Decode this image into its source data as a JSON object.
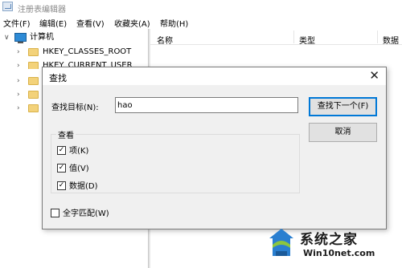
{
  "app": {
    "title": "注册表编辑器"
  },
  "menu": [
    {
      "label": "文件(F)"
    },
    {
      "label": "编辑(E)"
    },
    {
      "label": "查看(V)"
    },
    {
      "label": "收藏夹(A)"
    },
    {
      "label": "帮助(H)"
    }
  ],
  "tree": {
    "root_label": "计算机",
    "items": [
      {
        "label": "HKEY_CLASSES_ROOT"
      },
      {
        "label": "HKEY_CURRENT_USER"
      }
    ]
  },
  "list": {
    "columns": [
      {
        "label": "名称"
      },
      {
        "label": "类型"
      },
      {
        "label": "数据"
      }
    ]
  },
  "find_dialog": {
    "title": "查找",
    "close_glyph": "✕",
    "find_label": "查找目标(N):",
    "find_value": "hao",
    "find_next_label": "查找下一个(F)",
    "cancel_label": "取消",
    "look_at_label": "查看",
    "checkboxes": [
      {
        "label": "项(K)",
        "checked": true
      },
      {
        "label": "值(V)",
        "checked": true
      },
      {
        "label": "数据(D)",
        "checked": true
      }
    ],
    "match_whole": {
      "label": "全字匹配(W)",
      "checked": false
    }
  },
  "watermark": {
    "brand": "系统之家",
    "site": "Win10net.com"
  },
  "colors": {
    "accent": "#0078d7",
    "dialog_bg": "#f0f0f0",
    "folder": "#f3d27a"
  }
}
